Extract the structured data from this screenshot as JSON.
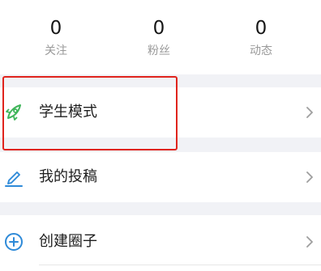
{
  "stats": [
    {
      "value": "0",
      "label": "关注"
    },
    {
      "value": "0",
      "label": "粉丝"
    },
    {
      "value": "0",
      "label": "动态"
    }
  ],
  "menu": [
    {
      "label": "学生模式",
      "icon": "rocket-icon"
    },
    {
      "label": "我的投稿",
      "icon": "pencil-icon"
    },
    {
      "label": "创建圈子",
      "icon": "plus-circle-icon"
    }
  ],
  "colors": {
    "accent_green": "#3fb55a",
    "accent_blue": "#2e8ad8",
    "highlight_red": "#e0241d",
    "chevron": "#9e9e9e"
  }
}
